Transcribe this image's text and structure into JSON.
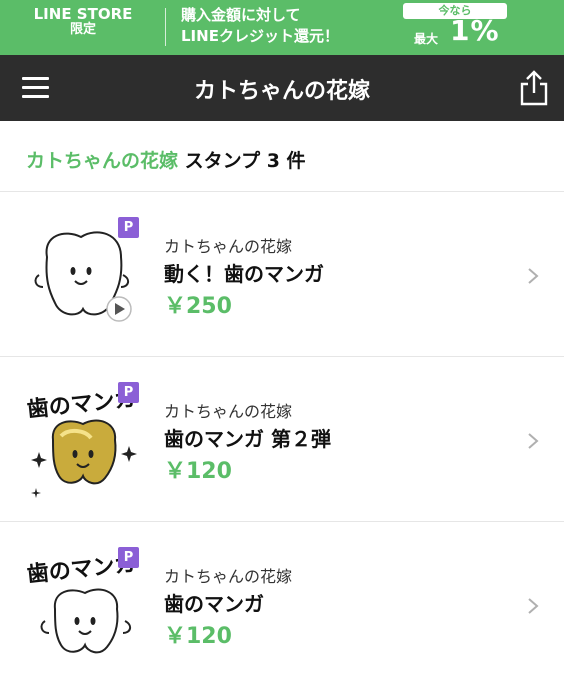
{
  "banner": {
    "store_line1": "LINE STORE",
    "store_line2": "限定",
    "promo_line1": "購入金額に対して",
    "promo_line2": "LINEクレジット還元！",
    "badge": "今なら",
    "max_label": "最大",
    "percent": "1%"
  },
  "nav": {
    "title": "カトちゃんの花嫁"
  },
  "listing": {
    "creator": "カトちゃんの花嫁",
    "kind": "スタンプ",
    "count": "3 件"
  },
  "items": [
    {
      "author": "カトちゃんの花嫁",
      "name": "動く！歯のマンガ",
      "price": "￥250",
      "badge": "P",
      "image_text": ""
    },
    {
      "author": "カトちゃんの花嫁",
      "name": "歯のマンガ 第２弾",
      "price": "￥120",
      "badge": "P",
      "image_text": "歯のマンガ"
    },
    {
      "author": "カトちゃんの花嫁",
      "name": "歯のマンガ",
      "price": "￥120",
      "badge": "P",
      "image_text": "歯のマンガ"
    }
  ],
  "colors": {
    "accent_green": "#5bbd68",
    "navbar": "#2d2d2d",
    "premium_badge": "#8b5fd6"
  },
  "icons": [
    "menu-icon",
    "share-icon",
    "chevron-right-icon",
    "play-icon"
  ]
}
